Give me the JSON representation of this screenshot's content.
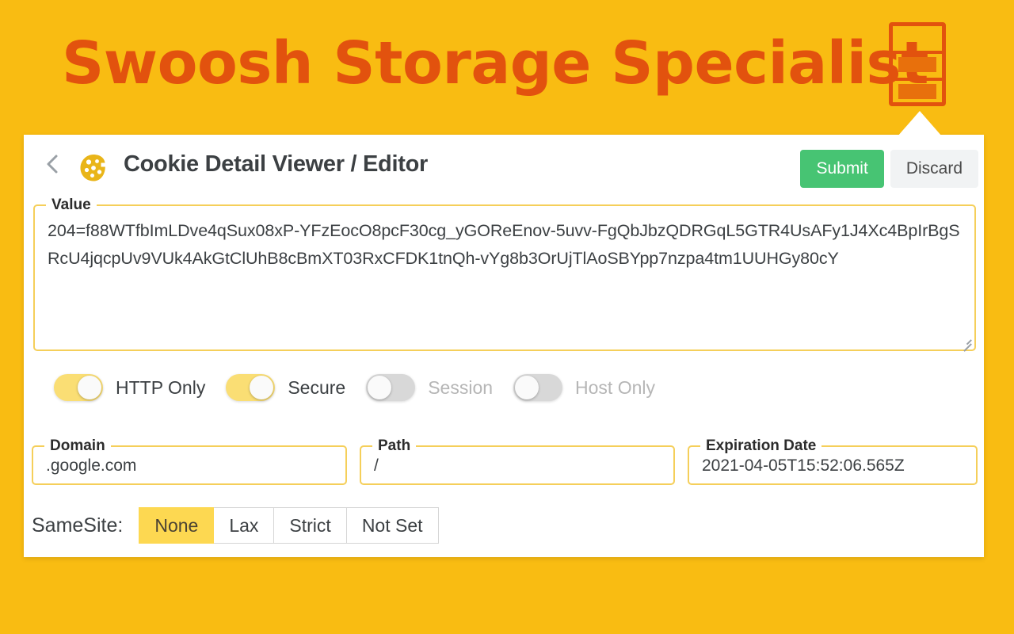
{
  "banner": {
    "title": "Swoosh Storage Specialist",
    "logo_icon": "storage-unit-icon",
    "brand_color": "#e2520e",
    "background_color": "#f9bc12"
  },
  "panel": {
    "back_icon": "chevron-left-icon",
    "title_icon": "cookie-icon",
    "title": "Cookie Detail Viewer / Editor",
    "actions": {
      "submit_label": "Submit",
      "submit_color": "#47c473",
      "discard_label": "Discard",
      "discard_color": "#f1f3f4"
    },
    "value_field": {
      "legend": "Value",
      "value": "204=f88WTfbImLDve4qSux08xP-YFzEocO8pcF30cg_yGOReEnov-5uvv-FgQbJbzQDRGqL5GTR4UsAFy1J4Xc4BpIrBgSRcU4jqcpUv9VUk4AkGtClUhB8cBmXT03RxCFDK1tnQh-vYg8b3OrUjTlAoSBYpp7nzpa4tm1UUHGy80cY",
      "resize_handle": "resize-grip-icon"
    },
    "toggles": [
      {
        "name": "http-only",
        "label": "HTTP Only",
        "state": "on",
        "disabled": false
      },
      {
        "name": "secure",
        "label": "Secure",
        "state": "on",
        "disabled": false
      },
      {
        "name": "session",
        "label": "Session",
        "state": "off",
        "disabled": true
      },
      {
        "name": "host-only",
        "label": "Host Only",
        "state": "off",
        "disabled": true
      }
    ],
    "fields": [
      {
        "name": "domain",
        "legend": "Domain",
        "value": ".google.com"
      },
      {
        "name": "path",
        "legend": "Path",
        "value": "/"
      },
      {
        "name": "expiration",
        "legend": "Expiration Date",
        "value": "2021-04-05T15:52:06.565Z"
      }
    ],
    "samesite": {
      "label": "SameSite:",
      "options": [
        "None",
        "Lax",
        "Strict",
        "Not Set"
      ],
      "selected": "None",
      "selected_color": "#fdd851"
    }
  }
}
